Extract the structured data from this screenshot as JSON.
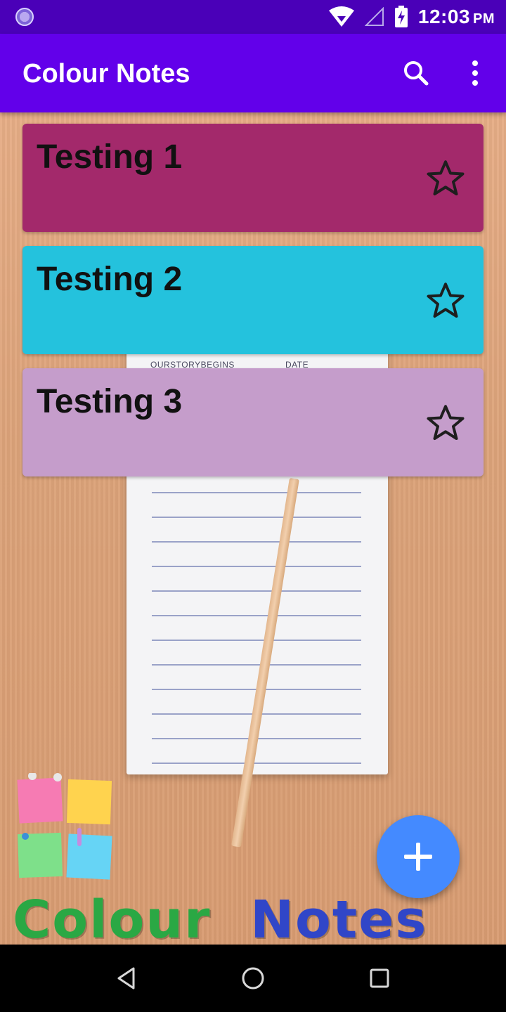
{
  "status_bar": {
    "time": "12:03",
    "ampm": "PM"
  },
  "app_bar": {
    "title": "Colour Notes",
    "icons": [
      "search-icon",
      "more-vert-icon"
    ]
  },
  "background": {
    "notepad_header": [
      "OURSTORYBEGINS",
      "DATE"
    ]
  },
  "notes": [
    {
      "title": "Testing 1",
      "color": "#a3296b",
      "starred": false
    },
    {
      "title": "Testing 2",
      "color": "#24c2dd",
      "starred": false
    },
    {
      "title": "Testing 3",
      "color": "#c59dcb",
      "starred": false
    }
  ],
  "logo": {
    "text_colour": "Colour",
    "text_notes": "Notes",
    "sticky_colors": [
      "#f67bb3",
      "#ffd34e",
      "#7ee08a",
      "#66d4f5"
    ]
  },
  "fab": {
    "icon": "plus-icon"
  },
  "nav_bar": {
    "icons": [
      "back-icon",
      "home-icon",
      "recents-icon"
    ]
  }
}
